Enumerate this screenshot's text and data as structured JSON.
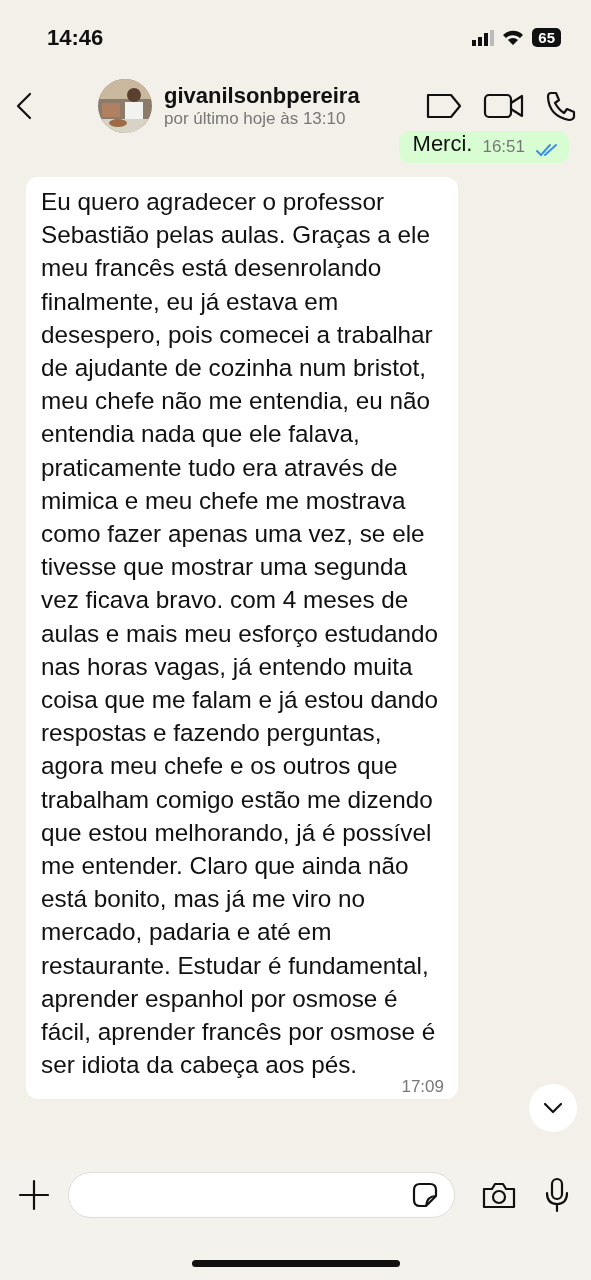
{
  "status_bar": {
    "time": "14:46",
    "battery": "65"
  },
  "header": {
    "name": "givanilsonbpereira",
    "last_seen": "por último hoje às 13:10"
  },
  "messages": [
    {
      "kind": "outgoing",
      "text": "Merci.",
      "time": "16:51",
      "read": true
    },
    {
      "kind": "incoming",
      "text": "Eu quero agradecer o professor Sebastião pelas aulas. Graças a ele meu francês está desenrolando finalmente, eu já estava em desespero, pois comecei a trabalhar de ajudante de cozinha num bristot, meu chefe não me entendia, eu não entendia nada que ele falava, praticamente tudo era através de mimica e meu chefe me mostrava como fazer apenas uma vez, se ele tivesse que mostrar uma segunda vez ficava bravo. com 4 meses de aulas e mais meu esforço estudando nas horas vagas, já entendo muita coisa que me falam e já estou dando respostas e fazendo perguntas, agora meu chefe e os outros que trabalham comigo estão me dizendo que estou melhorando, já é possível me entender. Claro que ainda não está bonito, mas já me viro no mercado, padaria e até em restaurante. Estudar é fundamental, aprender espanhol por osmose é fácil, aprender francês por osmose é ser idiota da cabeça aos pés.",
      "time": "17:09"
    }
  ]
}
